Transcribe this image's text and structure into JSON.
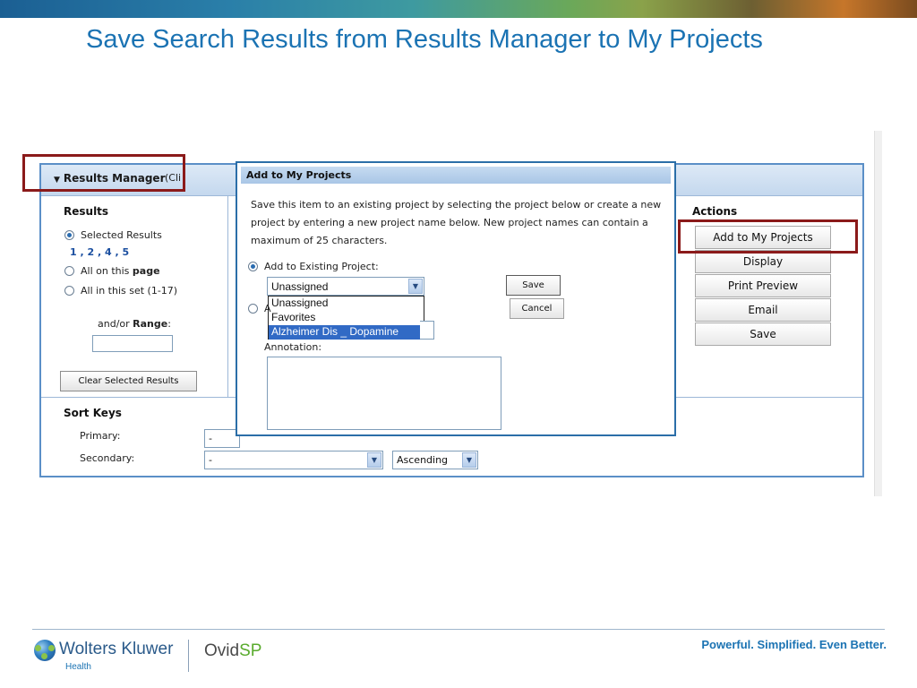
{
  "slide": {
    "title": "Save Search Results from Results Manager to My Projects",
    "tagline": "Powerful. Simplified. Even Better."
  },
  "footer": {
    "brand": "Wolters Kluwer",
    "brand_sub": "Health",
    "product_prefix": "Ovid",
    "product_suffix": "SP"
  },
  "results_manager": {
    "title": "Results Manager",
    "hint": "(Cli",
    "results": {
      "heading": "Results",
      "selected_label": "Selected Results",
      "selected_numbers": "1 , 2 , 4 , 5",
      "all_page_prefix": "All on this ",
      "all_page_bold": "page",
      "all_set_label": "All in this set (1-17)",
      "range_prefix": "and/or ",
      "range_bold": "Range",
      "range_suffix": ":",
      "range_value": "",
      "clear_button": "Clear Selected Results"
    },
    "actions": {
      "heading": "Actions",
      "buttons": [
        "Add to My Projects",
        "Display",
        "Print Preview",
        "Email",
        "Save"
      ]
    },
    "sort_keys": {
      "heading": "Sort Keys",
      "primary_label": "Primary:",
      "primary_value": "-",
      "secondary_label": "Secondary:",
      "secondary_value": "-",
      "order_value": "Ascending"
    }
  },
  "dialog": {
    "title": "Add to My Projects",
    "description": "Save this item to an existing project by selecting the project below or create a new project by entering a new project name below. New project names can contain a maximum of 25 characters.",
    "existing_label": "Add to Existing Project:",
    "existing_value": "Unassigned",
    "options": [
      "Unassigned",
      "Favorites",
      "Alzheimer Dis _ Dopamine"
    ],
    "selected_option": "Alzheimer Dis _ Dopamine",
    "new_radio_label": "A",
    "annotation_label": "Annotation:",
    "annotation_value": "",
    "save_button": "Save",
    "cancel_button": "Cancel"
  },
  "colors": {
    "title_blue": "#1b73b3",
    "highlight_red": "#8b1a1a",
    "panel_border": "#5b8fc7",
    "selected_option_bg": "#316ac5"
  },
  "icons": {
    "collapse": "triangle-down-icon",
    "dropdown": "chevron-down-icon",
    "scroll_up": "arrow-up-icon",
    "scroll_down": "arrow-down-icon",
    "logo": "globe-logo-icon"
  }
}
